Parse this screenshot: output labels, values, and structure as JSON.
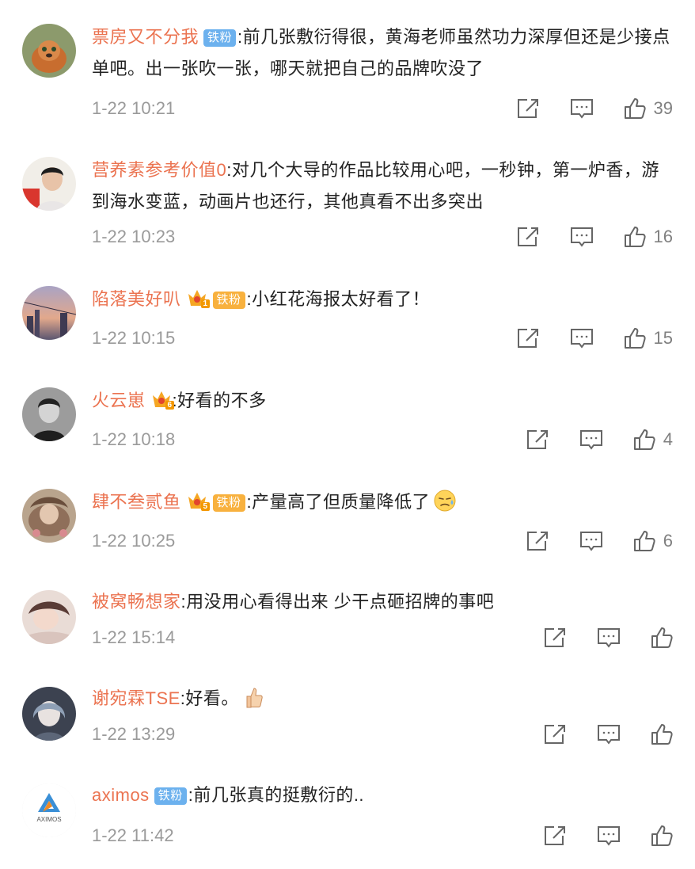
{
  "comments": [
    {
      "name": "票房又不分我",
      "badge": "铁粉",
      "text": ":前几张敷衍得很，黄海老师虽然功力深厚但还是少接点单吧。出一张吹一张，哪天就把自己的品牌吹没了",
      "time": "1-22 10:21",
      "likes": "39"
    },
    {
      "name": "营养素参考价值0",
      "text": ":对几个大导的作品比较用心吧，一秒钟，第一炉香，游到海水变蓝，动画片也还行，其他真看不出多突出",
      "time": "1-22 10:23",
      "likes": "16"
    },
    {
      "name": "陷落美好叭",
      "crown_level": "1",
      "badge": "铁粉",
      "text": ":小红花海报太好看了！",
      "time": "1-22 10:15",
      "likes": "15"
    },
    {
      "name": "火云崽",
      "crown_level": "6",
      "text": ":好看的不多",
      "time": "1-22 10:18",
      "likes": "4"
    },
    {
      "name": "肆不叁贰鱼",
      "crown_level": "5",
      "badge": "铁粉",
      "text": ":产量高了但质量降低了",
      "emoji": "sad-sweat-emoji",
      "time": "1-22 10:25",
      "likes": "6"
    },
    {
      "name": "被窝畅想家",
      "text": ":用没用心看得出来 少干点砸招牌的事吧",
      "time": "1-22 15:14",
      "likes": ""
    },
    {
      "name": "谢宛霖TSE",
      "text": ":好看。",
      "emoji": "thumbs-up-emoji",
      "time": "1-22 13:29",
      "likes": ""
    },
    {
      "name": "aximos",
      "badge": "铁粉",
      "text": ":前几张真的挺敷衍的..",
      "time": "1-22 11:42",
      "likes": "",
      "avatar_text": "AXIMOS"
    }
  ],
  "icons": {
    "share": "share-icon",
    "comment": "comment-icon",
    "like": "like-icon"
  },
  "colors": {
    "name": "#eb7350",
    "badge_blue": "#6cb1ee",
    "badge_orange": "#f8b13e",
    "meta": "#9a9a9a"
  }
}
